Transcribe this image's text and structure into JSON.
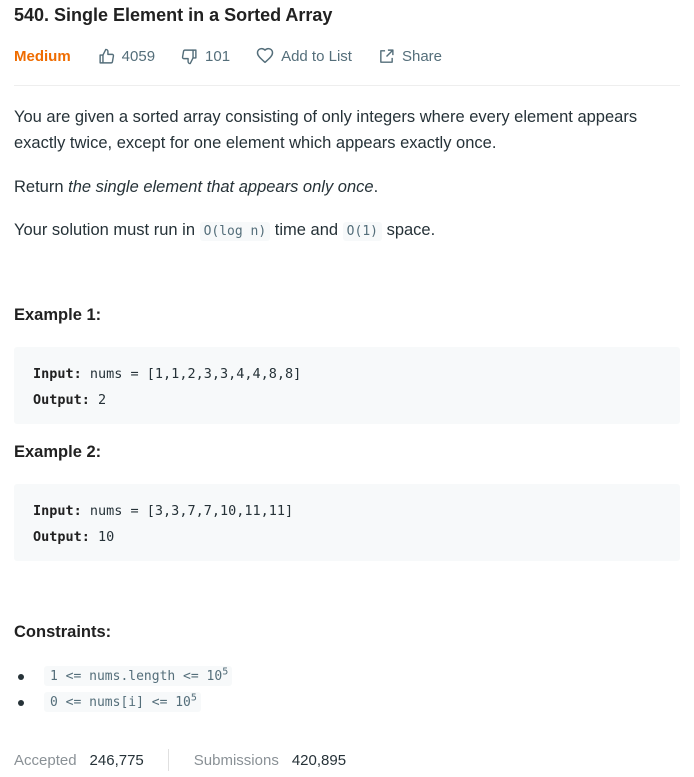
{
  "problem": {
    "title": "540. Single Element in a Sorted Array",
    "difficulty": "Medium",
    "likes": "4059",
    "dislikes": "101",
    "add_to_list": "Add to List",
    "share": "Share"
  },
  "description": {
    "p1": "You are given a sorted array consisting of only integers where every element appears exactly twice, except for one element which appears exactly once.",
    "p2_prefix": "Return ",
    "p2_em": "the single element that appears only once",
    "p2_suffix": ".",
    "p3_a": "Your solution must run in ",
    "p3_code1": "O(log n)",
    "p3_b": " time and ",
    "p3_code2": "O(1)",
    "p3_c": " space."
  },
  "examples": [
    {
      "heading": "Example 1:",
      "input_label": "Input:",
      "input_value": " nums = [1,1,2,3,3,4,4,8,8]",
      "output_label": "Output:",
      "output_value": " 2"
    },
    {
      "heading": "Example 2:",
      "input_label": "Input:",
      "input_value": " nums = [3,3,7,7,10,11,11]",
      "output_label": "Output:",
      "output_value": " 10"
    }
  ],
  "constraints": {
    "heading": "Constraints:",
    "items": [
      {
        "text": "1 <= nums.length <= 10",
        "exp": "5"
      },
      {
        "text": "0 <= nums[i] <= 10",
        "exp": "5"
      }
    ]
  },
  "stats": {
    "accepted_label": "Accepted",
    "accepted_value": "246,775",
    "submissions_label": "Submissions",
    "submissions_value": "420,895"
  },
  "colors": {
    "difficulty_medium": "#ef6c00",
    "code_bg": "#f7f9fa"
  },
  "icons": [
    "thumbs-up-icon",
    "thumbs-down-icon",
    "heart-icon",
    "share-icon"
  ]
}
